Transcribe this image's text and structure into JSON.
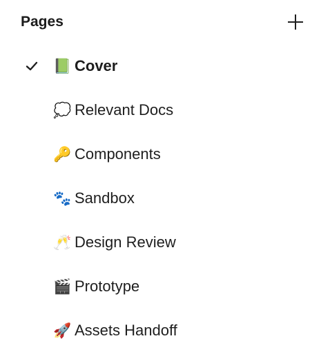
{
  "panel": {
    "title": "Pages",
    "add_icon": "plus-icon"
  },
  "pages": [
    {
      "emoji": "📗",
      "label": "Cover",
      "selected": true,
      "icon": "checkmark-icon"
    },
    {
      "emoji": "💭",
      "label": "Relevant Docs",
      "selected": false
    },
    {
      "emoji": "🔑",
      "label": "Components",
      "selected": false
    },
    {
      "emoji": "🐾",
      "label": "Sandbox",
      "selected": false
    },
    {
      "emoji": "🥂",
      "label": "Design Review",
      "selected": false
    },
    {
      "emoji": "🎬",
      "label": "Prototype",
      "selected": false
    },
    {
      "emoji": "🚀",
      "label": "Assets Handoff",
      "selected": false
    }
  ]
}
